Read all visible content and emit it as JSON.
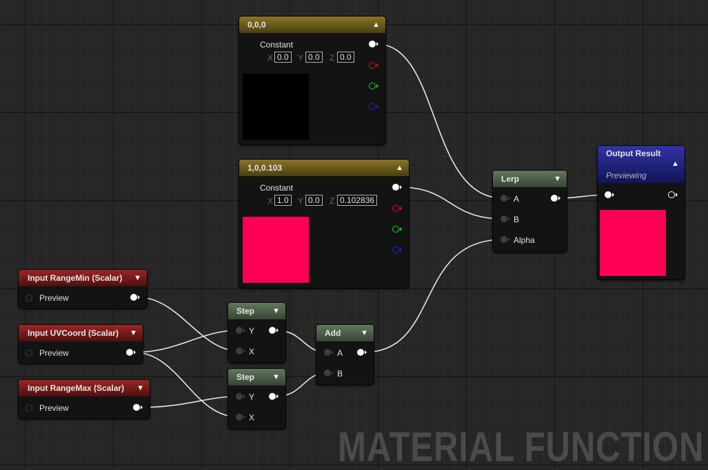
{
  "watermark": "MATERIAL FUNCTION",
  "colors": {
    "wire": "#e8e8e8",
    "black_swatch": "#000000",
    "pink_swatch": "#ff0055",
    "red_channel": "#e21414",
    "green_channel": "#14d814",
    "blue_channel": "#1c24e0"
  },
  "nodes": {
    "constant_black": {
      "title": "0,0,0",
      "label": "Constant",
      "x_label": "X",
      "x_value": "0.0",
      "y_label": "Y",
      "y_value": "0.0",
      "z_label": "Z",
      "z_value": "0.0"
    },
    "constant_pink": {
      "title": "1,0,0.103",
      "label": "Constant",
      "x_label": "X",
      "x_value": "1.0",
      "y_label": "Y",
      "y_value": "0.0",
      "z_label": "Z",
      "z_value": "0.102836"
    },
    "lerp": {
      "title": "Lerp",
      "pins": [
        "A",
        "B",
        "Alpha"
      ]
    },
    "output_result": {
      "title": "Output Result",
      "subtitle": "Previewing"
    },
    "input_range_min": {
      "title": "Input RangeMin (Scalar)",
      "output_label": "Preview"
    },
    "input_uvcoord": {
      "title": "Input UVCoord (Scalar)",
      "output_label": "Preview"
    },
    "input_range_max": {
      "title": "Input RangeMax (Scalar)",
      "output_label": "Preview"
    },
    "step_1": {
      "title": "Step",
      "pins": [
        "Y",
        "X"
      ]
    },
    "step_2": {
      "title": "Step",
      "pins": [
        "Y",
        "X"
      ]
    },
    "add": {
      "title": "Add",
      "pins": [
        "A",
        "B"
      ]
    }
  }
}
